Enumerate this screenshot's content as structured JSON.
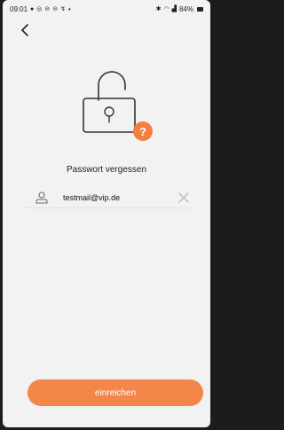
{
  "status_bar": {
    "time": "09:01",
    "notification_icons": [
      "app-icon",
      "whatsapp-icon",
      "chat-icon",
      "chat-icon",
      "usb-icon"
    ],
    "dot": "•",
    "battery": "84%",
    "right_icons": [
      "bluetooth-icon",
      "wifi-icon",
      "signal-icon",
      "battery-icon"
    ]
  },
  "header": {
    "back_icon": "back-chevron-icon"
  },
  "illustration": {
    "lock_icon": "open-padlock-icon",
    "badge_text": "?",
    "badge_color": "#f07f40"
  },
  "page": {
    "title": "Passwort vergessen"
  },
  "form": {
    "email_value": "testmail@vip.de",
    "user_icon": "user-icon",
    "clear_icon": "close-icon"
  },
  "actions": {
    "submit_label": "einreichen",
    "accent_color": "#f5864a"
  }
}
